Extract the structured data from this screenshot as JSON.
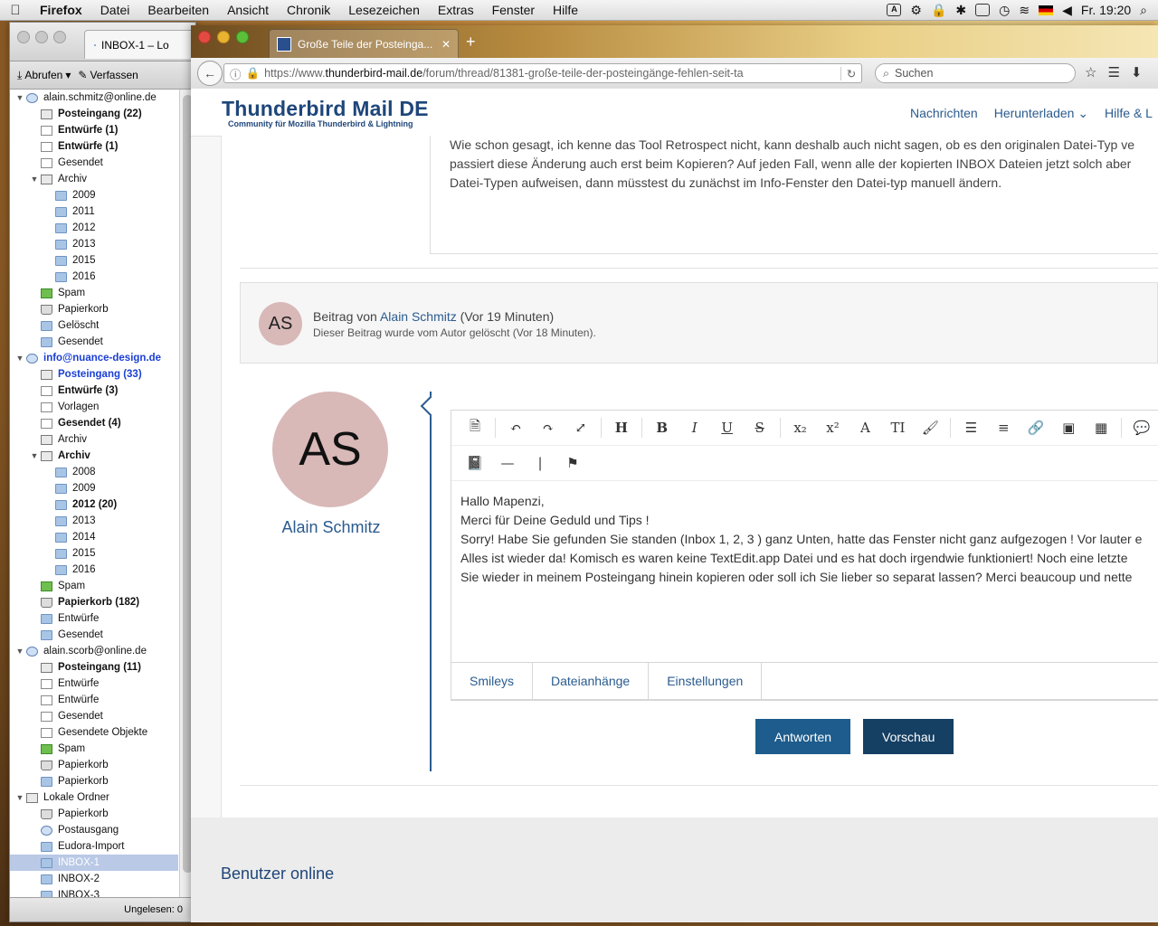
{
  "menubar": {
    "app": "Firefox",
    "items": [
      "Datei",
      "Bearbeiten",
      "Ansicht",
      "Chronik",
      "Lesezeichen",
      "Extras",
      "Fenster",
      "Hilfe"
    ],
    "clock": "Fr. 19:20"
  },
  "thunderbird": {
    "tab_title": "INBOX-1 – Lo",
    "toolbar": {
      "fetch": "Abrufen",
      "compose": "Verfassen"
    },
    "folders": [
      {
        "label": "alain.schmitz@online.de",
        "level": 0,
        "icon": "account",
        "twisty": "open"
      },
      {
        "label": "Posteingang (22)",
        "level": 1,
        "icon": "inbox",
        "bold": true
      },
      {
        "label": "Entwürfe (1)",
        "level": 1,
        "icon": "doc",
        "bold": true
      },
      {
        "label": "Entwürfe (1)",
        "level": 1,
        "icon": "doc",
        "bold": true
      },
      {
        "label": "Gesendet",
        "level": 1,
        "icon": "doc"
      },
      {
        "label": "Archiv",
        "level": 1,
        "icon": "inbox",
        "twisty": "open"
      },
      {
        "label": "2009",
        "level": 2,
        "icon": "folder"
      },
      {
        "label": "2011",
        "level": 2,
        "icon": "folder"
      },
      {
        "label": "2012",
        "level": 2,
        "icon": "folder"
      },
      {
        "label": "2013",
        "level": 2,
        "icon": "folder"
      },
      {
        "label": "2015",
        "level": 2,
        "icon": "folder"
      },
      {
        "label": "2016",
        "level": 2,
        "icon": "folder"
      },
      {
        "label": "Spam",
        "level": 1,
        "icon": "spam"
      },
      {
        "label": "Papierkorb",
        "level": 1,
        "icon": "trash"
      },
      {
        "label": "Gelöscht",
        "level": 1,
        "icon": "folder"
      },
      {
        "label": "Gesendet",
        "level": 1,
        "icon": "folder"
      },
      {
        "label": "info@nuance-design.de",
        "level": 0,
        "icon": "account",
        "twisty": "open",
        "bold": true,
        "blue": true
      },
      {
        "label": "Posteingang (33)",
        "level": 1,
        "icon": "inbox",
        "bold": true,
        "blue": true
      },
      {
        "label": "Entwürfe (3)",
        "level": 1,
        "icon": "doc",
        "bold": true
      },
      {
        "label": "Vorlagen",
        "level": 1,
        "icon": "doc"
      },
      {
        "label": "Gesendet (4)",
        "level": 1,
        "icon": "doc",
        "bold": true
      },
      {
        "label": "Archiv",
        "level": 1,
        "icon": "inbox"
      },
      {
        "label": "Archiv",
        "level": 1,
        "icon": "inbox",
        "twisty": "open",
        "bold": true
      },
      {
        "label": "2008",
        "level": 2,
        "icon": "folder"
      },
      {
        "label": "2009",
        "level": 2,
        "icon": "folder"
      },
      {
        "label": "2012 (20)",
        "level": 2,
        "icon": "folder",
        "bold": true
      },
      {
        "label": "2013",
        "level": 2,
        "icon": "folder"
      },
      {
        "label": "2014",
        "level": 2,
        "icon": "folder"
      },
      {
        "label": "2015",
        "level": 2,
        "icon": "folder"
      },
      {
        "label": "2016",
        "level": 2,
        "icon": "folder"
      },
      {
        "label": "Spam",
        "level": 1,
        "icon": "spam"
      },
      {
        "label": "Papierkorb (182)",
        "level": 1,
        "icon": "trash",
        "bold": true
      },
      {
        "label": "Entwürfe",
        "level": 1,
        "icon": "folder"
      },
      {
        "label": "Gesendet",
        "level": 1,
        "icon": "folder"
      },
      {
        "label": "alain.scorb@online.de",
        "level": 0,
        "icon": "account",
        "twisty": "open"
      },
      {
        "label": "Posteingang (11)",
        "level": 1,
        "icon": "inbox",
        "bold": true
      },
      {
        "label": "Entwürfe",
        "level": 1,
        "icon": "doc"
      },
      {
        "label": "Entwürfe",
        "level": 1,
        "icon": "doc"
      },
      {
        "label": "Gesendet",
        "level": 1,
        "icon": "doc"
      },
      {
        "label": "Gesendete Objekte",
        "level": 1,
        "icon": "doc"
      },
      {
        "label": "Spam",
        "level": 1,
        "icon": "spam"
      },
      {
        "label": "Papierkorb",
        "level": 1,
        "icon": "trash"
      },
      {
        "label": "Papierkorb",
        "level": 1,
        "icon": "folder"
      },
      {
        "label": "Lokale Ordner",
        "level": 0,
        "icon": "inbox",
        "twisty": "open"
      },
      {
        "label": "Papierkorb",
        "level": 1,
        "icon": "trash"
      },
      {
        "label": "Postausgang",
        "level": 1,
        "icon": "account"
      },
      {
        "label": "Eudora-Import",
        "level": 1,
        "icon": "folder"
      },
      {
        "label": "INBOX-1",
        "level": 1,
        "icon": "folder",
        "selected": true
      },
      {
        "label": "INBOX-2",
        "level": 1,
        "icon": "folder"
      },
      {
        "label": "INBOX-3",
        "level": 1,
        "icon": "folder"
      }
    ],
    "status": "Ungelesen: 0"
  },
  "firefox": {
    "tab_title": "Große Teile der Posteinga...",
    "url_prefix": "https://www.",
    "url_host": "thunderbird-mail.de",
    "url_path": "/forum/thread/81381-große-teile-der-posteingänge-fehlen-seit-ta",
    "search_placeholder": "Suchen"
  },
  "site": {
    "logo_title": "Thunderbird Mail DE",
    "logo_subtitle": "Community für Mozilla Thunderbird & Lightning",
    "nav": [
      "Nachrichten",
      "Herunterladen ⌄",
      "Hilfe & L"
    ]
  },
  "thread": {
    "previous_message_lines": [
      "Wie schon gesagt, ich kenne das Tool Retrospect nicht, kann deshalb auch nicht sagen, ob es den originalen Datei-Typ ve",
      "passiert diese Änderung auch erst beim Kopieren? Auf jeden Fall, wenn alle der kopierten INBOX Dateien jetzt solch aber",
      "Datei-Typen aufweisen, dann müsstest du zunächst im Info-Fenster den Datei-typ manuell ändern."
    ],
    "deleted_post": {
      "initials": "AS",
      "prefix": "Beitrag von",
      "author": "Alain Schmitz",
      "time": "(Vor 19 Minuten)",
      "note": "Dieser Beitrag wurde vom Autor gelöscht (Vor 18 Minuten)."
    },
    "reply": {
      "initials": "AS",
      "author": "Alain Schmitz",
      "editor_lines": [
        "Hallo Mapenzi,",
        "Merci für Deine Geduld und Tips !",
        "Sorry! Habe Sie gefunden Sie standen (Inbox 1, 2, 3 ) ganz Unten, hatte das Fenster nicht ganz aufgezogen ! Vor lauter e",
        "Alles ist wieder da! Komisch es waren keine TextEdit.app Datei und es hat doch irgendwie funktioniert! Noch eine letzte",
        "Sie wieder in meinem Posteingang hinein kopieren oder soll ich Sie lieber so separat lassen? Merci beaucoup und nette"
      ],
      "tabs": [
        "Smileys",
        "Dateianhänge",
        "Einstellungen"
      ],
      "reply_button": "Antworten",
      "preview_button": "Vorschau"
    },
    "online_heading": "Benutzer online"
  },
  "colors": {
    "link": "#2a5b8f",
    "primary_button": "#1d5c8c",
    "secondary_button": "#153f63",
    "avatar": "#d9b8b8"
  }
}
